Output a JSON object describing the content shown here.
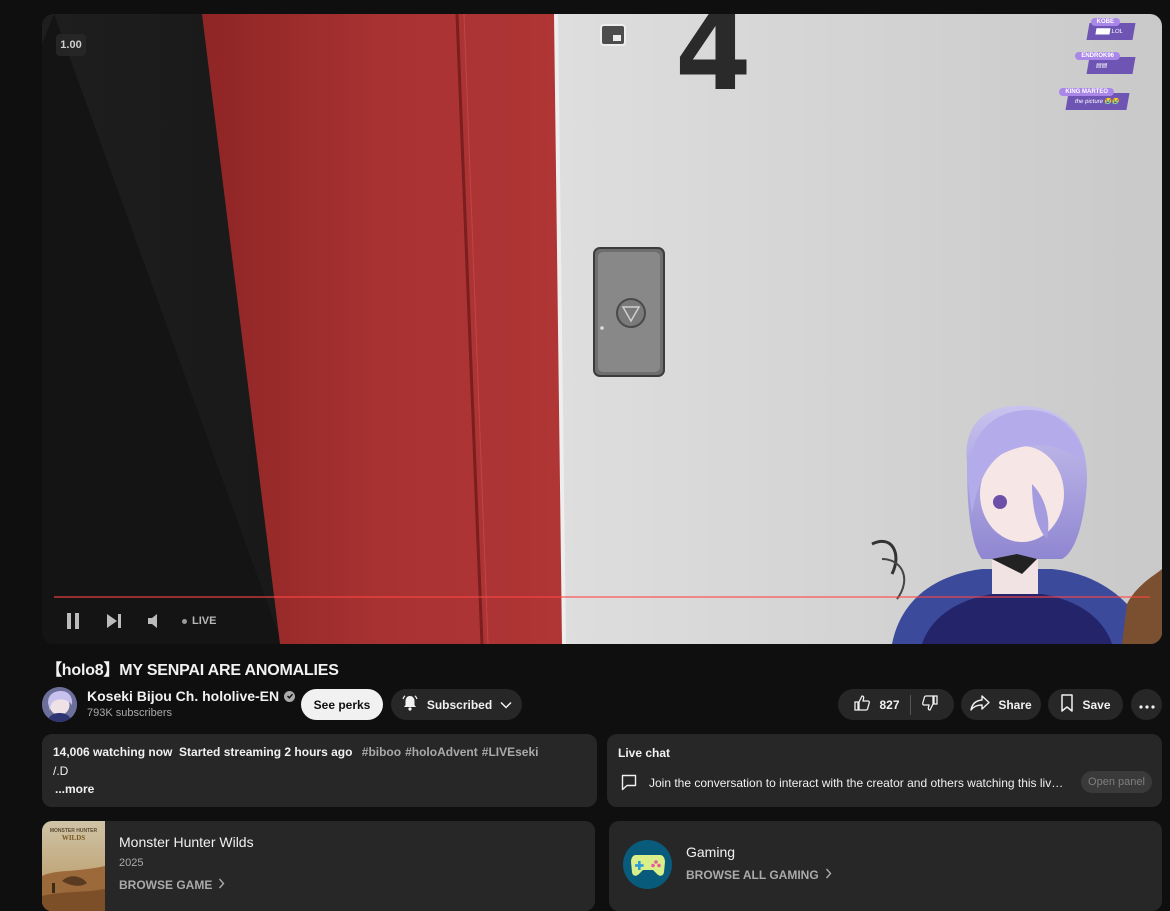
{
  "player": {
    "speed": "1.00",
    "live_label": "LIVE",
    "chat_overlay": [
      {
        "name": "KOBE",
        "message": "LOL"
      },
      {
        "name": "ENDROK96",
        "message": ""
      },
      {
        "name": "KING MARTEO",
        "message": "the picture 😭😭"
      }
    ]
  },
  "video": {
    "title": "【holo8】MY SENPAI ARE ANOMALIES"
  },
  "channel": {
    "name": "Koseki Bijou Ch. hololive-EN",
    "subscribers": "793K subscribers"
  },
  "actions": {
    "perks_label": "See perks",
    "subscribed_label": "Subscribed",
    "like_count": "827",
    "share_label": "Share",
    "save_label": "Save"
  },
  "description": {
    "watching": "14,006 watching now",
    "started": "Started streaming 2 hours ago",
    "tags": [
      "#biboo",
      "#holoAdvent",
      "#LIVEseki"
    ],
    "text": "/.D",
    "more_label": "...more"
  },
  "live_chat": {
    "header": "Live chat",
    "prompt": "Join the conversation to interact with the creator and others watching this live stream.",
    "open_panel_label": "Open panel"
  },
  "game_card": {
    "title": "Monster Hunter Wilds",
    "year": "2025",
    "browse_label": "BROWSE GAME"
  },
  "gaming_card": {
    "title": "Gaming",
    "browse_label": "BROWSE ALL GAMING"
  }
}
